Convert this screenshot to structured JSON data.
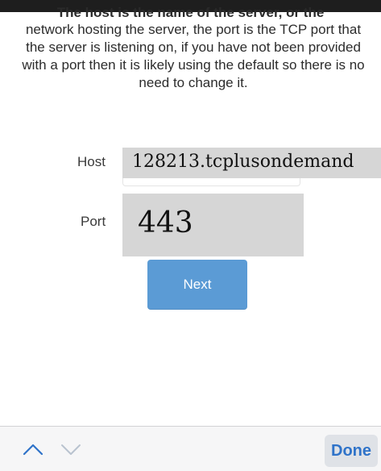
{
  "instructions": {
    "clipped_line": "The host is the name of the server, or the",
    "text": "network hosting the server, the port is the TCP port that the server is listening on, if you have not been provided with a port then it is likely using the default so there is no need to change it."
  },
  "form": {
    "host_label": "Host",
    "host_value": "128213.tcplusondemand",
    "port_label": "Port",
    "port_value": "443"
  },
  "next_button": {
    "label": "Next"
  },
  "keyboard_toolbar": {
    "previous_icon": "chevron-up-icon",
    "next_icon": "chevron-down-icon",
    "done_label": "Done"
  },
  "colors": {
    "top_bar": "#1e1e1e",
    "input_background": "#d6d6d6",
    "next_button": "#5b9bd5",
    "done_text": "#2f73c9",
    "toolbar_background": "#f6f6f7"
  }
}
